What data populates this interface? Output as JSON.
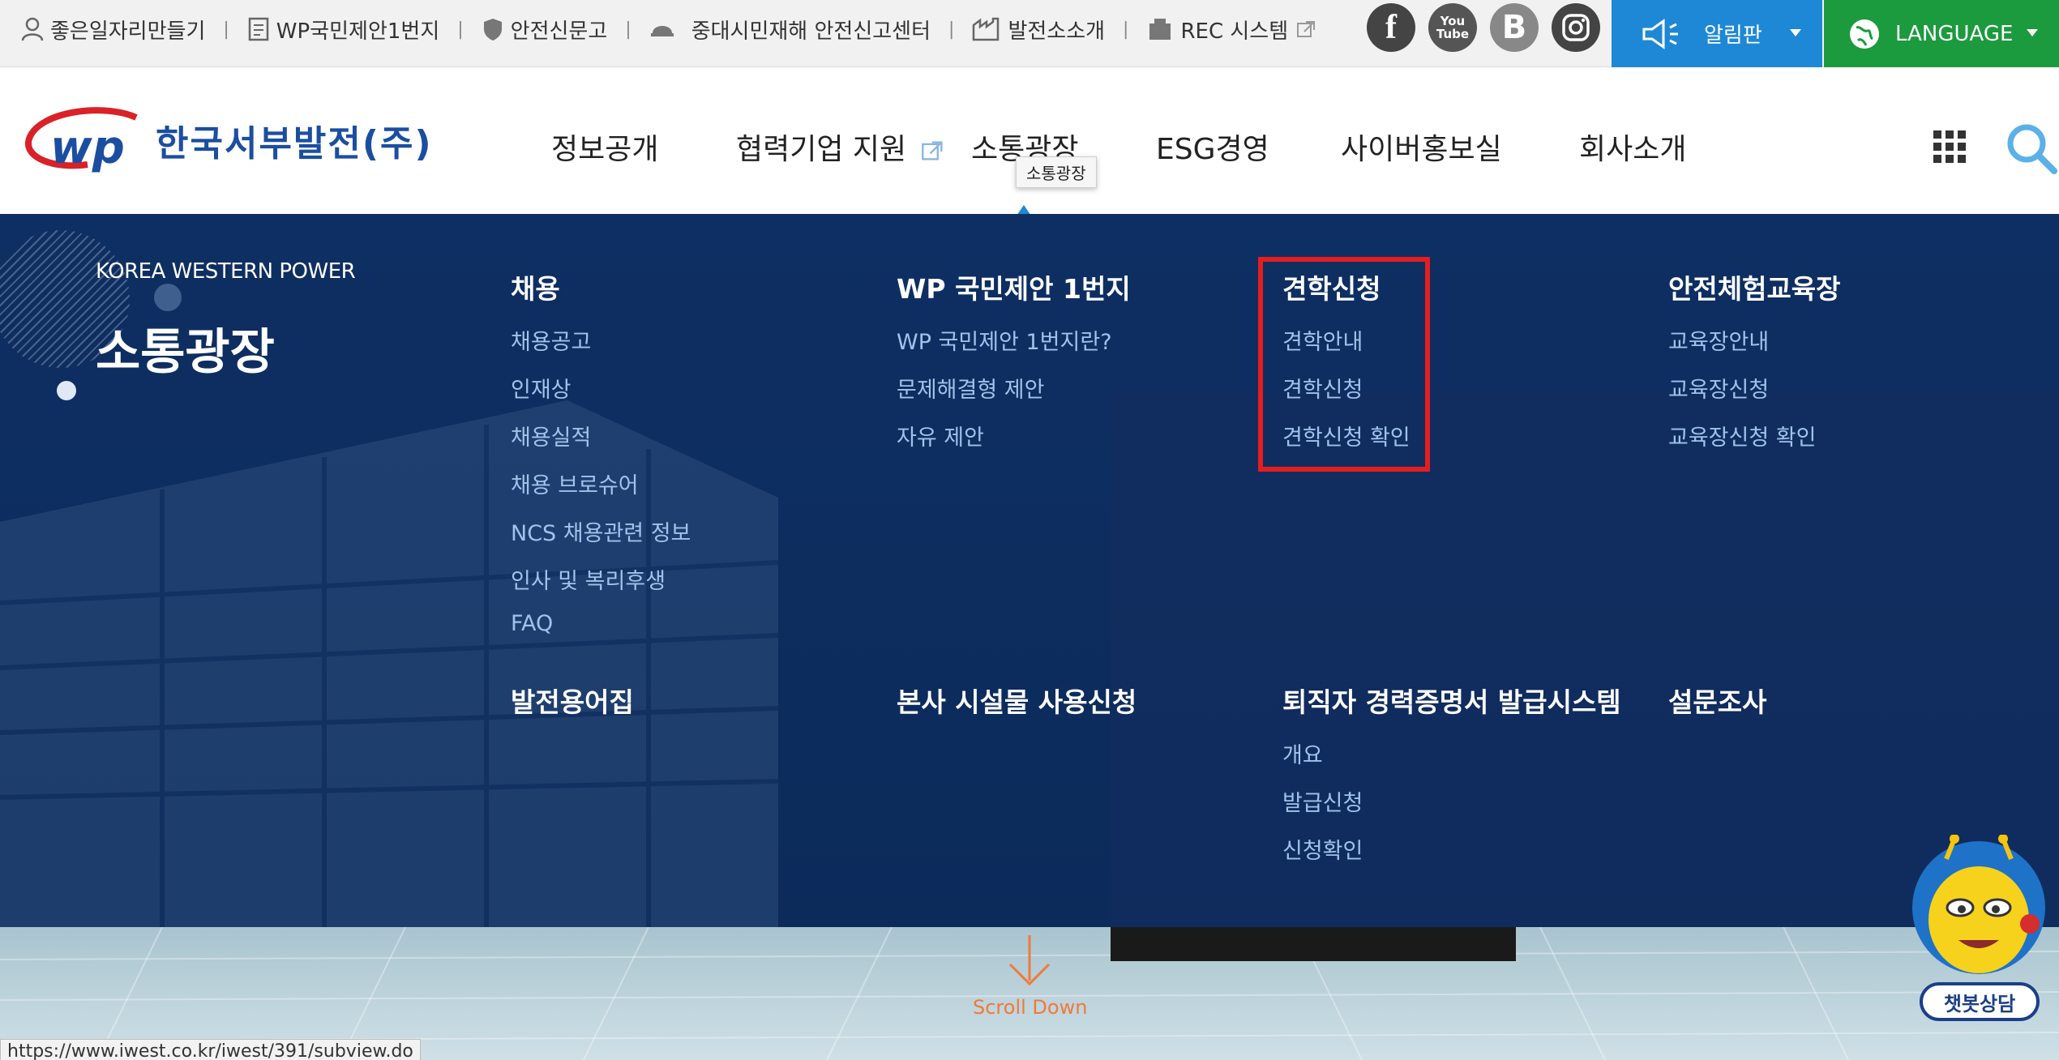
{
  "util": {
    "links": [
      "좋은일자리만들기",
      "WP국민제안1번지",
      "안전신문고",
      "중대시민재해 안전신고센터",
      "발전소소개",
      "REC 시스템"
    ],
    "social": {
      "facebook": "f",
      "youtube": "You\nTube",
      "blog": "B",
      "instagram": "instagram"
    },
    "notice_label": "알림판",
    "language_label": "LANGUAGE"
  },
  "header": {
    "logo_text": "한국서부발전(주)",
    "nav": [
      "정보공개",
      "협력기업 지원",
      "소통광장",
      "ESG경영",
      "사이버홍보실",
      "회사소개"
    ],
    "tooltip": "소통광장"
  },
  "mega": {
    "brand_en": "KOREA WESTERN POWER",
    "brand_ko": "소통광장",
    "columns": [
      {
        "title": "채용",
        "links": [
          "채용공고",
          "인재상",
          "채용실적",
          "채용 브로슈어",
          "NCS 채용관련 정보",
          "인사 및 복리후생",
          "FAQ"
        ]
      },
      {
        "title": "WP 국민제안 1번지",
        "links": [
          "WP 국민제안 1번지란?",
          "문제해결형 제안",
          "자유 제안"
        ]
      },
      {
        "title": "견학신청",
        "links": [
          "견학안내",
          "견학신청",
          "견학신청 확인"
        ]
      },
      {
        "title": "안전체험교육장",
        "links": [
          "교육장안내",
          "교육장신청",
          "교육장신청 확인"
        ]
      },
      {
        "title": "발전용어집",
        "links": []
      },
      {
        "title": "본사 시설물 사용신청",
        "links": []
      },
      {
        "title": "퇴직자 경력증명서 발급시스템",
        "links": [
          "개요",
          "발급신청",
          "신청확인"
        ]
      },
      {
        "title": "설문조사",
        "links": []
      }
    ]
  },
  "bottom": {
    "scroll_down": "Scroll Down",
    "status_url": "https://www.iwest.co.kr/iwest/391/subview.do",
    "chatbot_label": "챗봇상담"
  },
  "colors": {
    "notice_bg": "#1e88d6",
    "language_bg": "#1c9a3e",
    "mega_bg": "#0e2f63",
    "highlight": "#e41e1e",
    "link": "#9fc3ea"
  }
}
